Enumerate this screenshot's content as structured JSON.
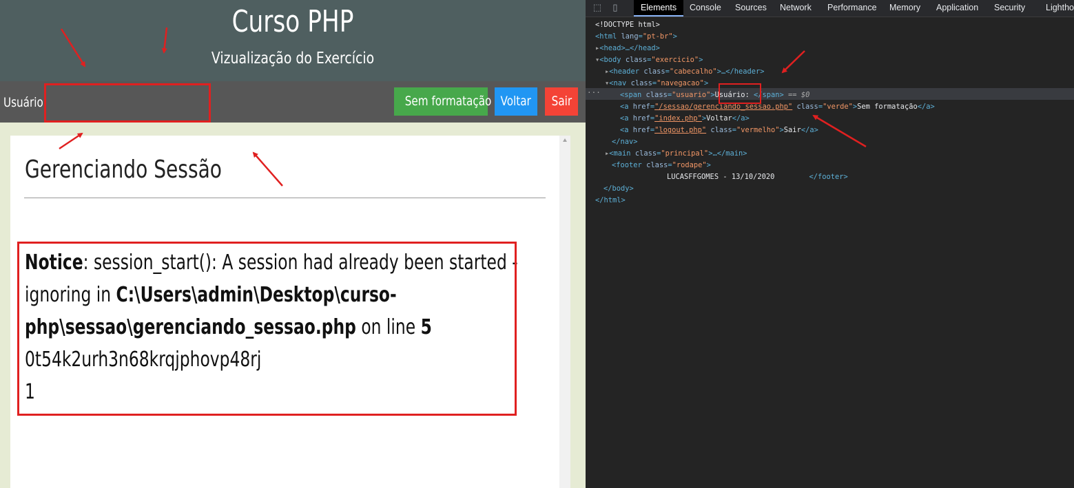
{
  "site": {
    "title": "Curso PHP",
    "subtitle": "Vizualização do Exercício"
  },
  "nav": {
    "user_label": "Usuário:",
    "buttons": {
      "plain": "Sem formatação",
      "back": "Voltar",
      "logout": "Sair"
    }
  },
  "main": {
    "heading": "Gerenciando Sessão",
    "notice": {
      "label": "Notice",
      "part1": ": session_start(): A session had already been started -",
      "part2": "ignoring in ",
      "path1": "C:\\Users\\admin\\Desktop\\curso-",
      "path2": "php\\sessao\\gerenciando_sessao.php",
      "online": " on line ",
      "line": "5",
      "session_id": "0t54k2urh3n68krqjphovp48rj",
      "value": "1"
    }
  },
  "devtools": {
    "tabs": [
      "Elements",
      "Console",
      "Sources",
      "Network",
      "Performance",
      "Memory",
      "Application",
      "Security",
      "Lighthouse"
    ],
    "dom": {
      "doctype": "<!DOCTYPE html>",
      "html_open": "<html",
      "lang_attr": "lang",
      "lang_val": "\"pt-br\"",
      "head": "<head>…</head>",
      "body_open": "<body",
      "class_attr": "class",
      "body_class": "\"exercicio\"",
      "header_open": "<header",
      "header_class": "\"cabecalho\"",
      "header_close": ">…</header>",
      "nav_open": "<nav",
      "nav_class": "\"navegacao\"",
      "span_open": "<span",
      "span_class": "\"usuario\"",
      "span_text": "Usuário: ",
      "span_close": "</span>",
      "eq": " == ",
      "dollar": "$0",
      "a_open": "<a",
      "href_attr": "href",
      "href1": "\"/sessao/gerenciando_sessao.php\"",
      "class1": "\"verde\"",
      "a_text1": "Sem formatação",
      "a_close": "</a>",
      "href2": "\"index.php\"",
      "a_text2": "Voltar",
      "href3": "\"logout.php\"",
      "class3": "\"vermelho\"",
      "a_text3": "Sair",
      "nav_close": "</nav>",
      "main_open": "<main",
      "main_class": "\"principal\"",
      "main_close": ">…</main>",
      "footer_open": "<footer",
      "footer_class": "\"rodape\"",
      "footer_text": "LUCASFFGOMES - 13/10/2020",
      "footer_close": "</footer>",
      "body_close": "</body>",
      "html_close": "</html>"
    }
  },
  "colors": {
    "header_bg": "#4f5f60",
    "nav_bg": "#575757",
    "green": "#47a84b",
    "blue": "#2196f3",
    "red": "#f44336",
    "annotation_red": "#e02020"
  }
}
